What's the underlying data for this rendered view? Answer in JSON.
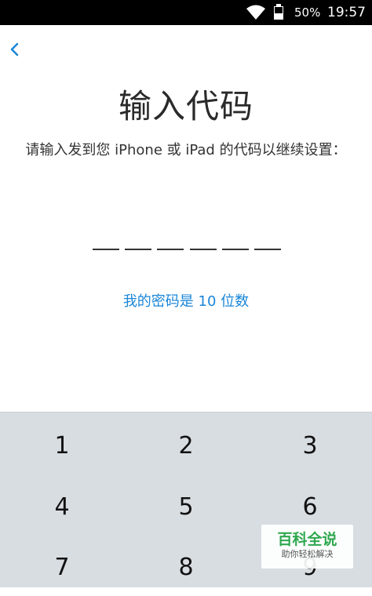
{
  "status_bar": {
    "battery_percent": "50%",
    "battery_level": 0.5,
    "time": "19:57",
    "icons": [
      "wifi-icon",
      "battery-icon"
    ]
  },
  "header": {
    "back_icon": "chevron-left-icon"
  },
  "main": {
    "title": "输入代码",
    "subtitle": "请输入发到您 iPhone 或 iPad 的代码以继续设置：",
    "code_slots": 6,
    "code_value": "",
    "link": "我的密码是 10 位数"
  },
  "keypad": {
    "keys": [
      "1",
      "2",
      "3",
      "4",
      "5",
      "6",
      "7",
      "8",
      "9"
    ]
  },
  "watermark": {
    "title": "百科全说",
    "subtitle": "助你轻松解决"
  },
  "colors": {
    "accent": "#1a86d8",
    "keypad_bg": "#d8dde2",
    "watermark_green": "#2fa84f"
  }
}
